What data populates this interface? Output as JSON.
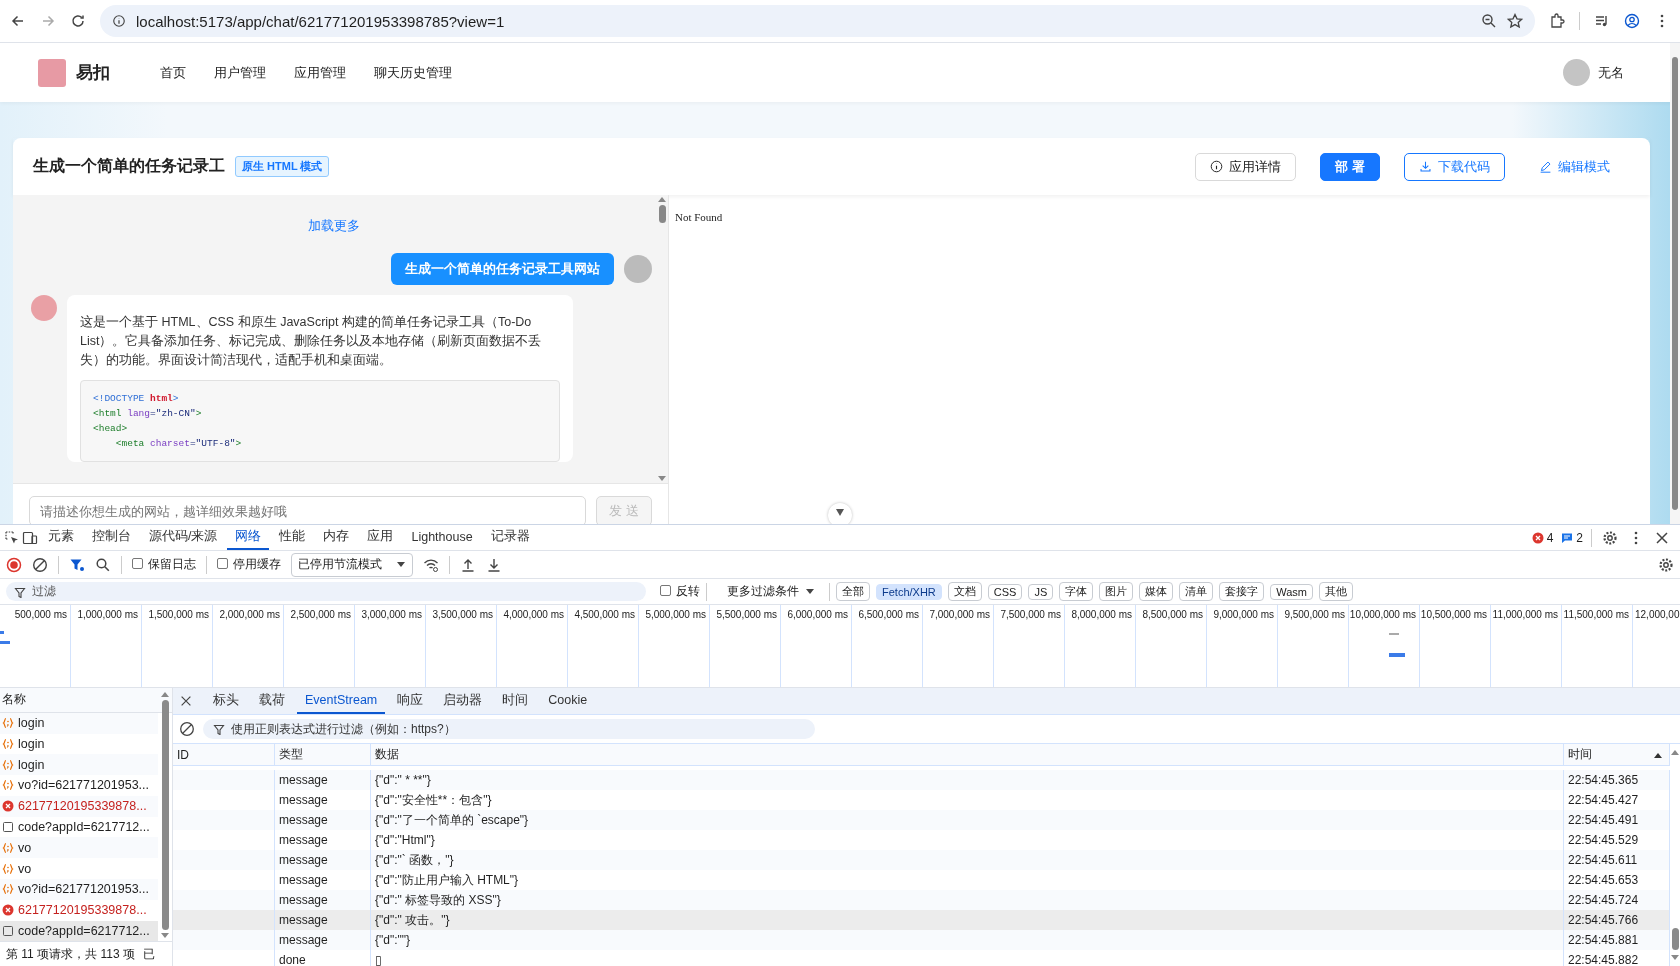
{
  "browser": {
    "url": "localhost:5173/app/chat/621771201953398785?view=1"
  },
  "app_header": {
    "brand": "易扣",
    "nav": [
      {
        "label": "首页"
      },
      {
        "label": "用户管理"
      },
      {
        "label": "应用管理"
      },
      {
        "label": "聊天历史管理"
      }
    ],
    "user": "无名"
  },
  "card": {
    "title": "生成一个简单的任务记录工",
    "badge": "原生 HTML 模式",
    "actions": [
      {
        "label": "应用详情",
        "kind": "default"
      },
      {
        "label": "部 署",
        "kind": "primary"
      },
      {
        "label": "下载代码",
        "kind": "outline"
      },
      {
        "label": "编辑模式",
        "kind": "link"
      }
    ]
  },
  "chat": {
    "load_more": "加载更多",
    "messages": [
      {
        "kind": "user",
        "text": "生成一个简单的任务记录工具网站"
      },
      {
        "kind": "ai",
        "text": "这是一个基于 HTML、CSS 和原生 JavaScript 构建的简单任务记录工具（To-Do List）。它具备添加任务、标记完成、删除任务以及本地存储（刷新页面数据不丢失）的功能。界面设计简洁现代，适配手机和桌面端。",
        "code_lines": [
          [
            {
              "text": "<!DOCTYPE ",
              "kind": "punct"
            },
            {
              "text": "html",
              "kind": "keyword"
            },
            {
              "text": ">",
              "kind": "punct"
            }
          ],
          [
            {
              "text": "<html",
              "kind": "tag"
            },
            {
              "text": " lang",
              "kind": "attr"
            },
            {
              "text": "=\"zh-CN\"",
              "kind": "string"
            },
            {
              "text": ">",
              "kind": "tag"
            }
          ],
          [
            {
              "text": "<head>",
              "kind": "tag"
            }
          ],
          [
            {
              "text": "    <meta",
              "kind": "tag"
            },
            {
              "text": " charset",
              "kind": "attr"
            },
            {
              "text": "=\"UTF-8\"",
              "kind": "string"
            },
            {
              "text": ">",
              "kind": "tag"
            }
          ]
        ]
      }
    ],
    "input": {
      "placeholder": "请描述你想生成的网站，越详细效果越好哦"
    },
    "send_button": {
      "label": "发 送",
      "disabled": true
    }
  },
  "preview": {
    "text": "Not Found"
  },
  "devtools": {
    "tabs": [
      {
        "label": "元素",
        "selected": false
      },
      {
        "label": "控制台",
        "selected": false
      },
      {
        "label": "源代码/来源",
        "selected": false
      },
      {
        "label": "网络",
        "selected": true
      },
      {
        "label": "性能",
        "selected": false
      },
      {
        "label": "内存",
        "selected": false
      },
      {
        "label": "应用",
        "selected": false
      },
      {
        "label": "Lighthouse",
        "selected": false
      },
      {
        "label": "记录器",
        "selected": false
      }
    ],
    "error_count": "4",
    "message_count": "2",
    "toolbar": {
      "preserve_log": {
        "label": "保留日志",
        "checked": false
      },
      "disable_cache": {
        "label": "停用缓存",
        "checked": false
      },
      "throttling": "已停用节流模式"
    },
    "filter": {
      "placeholder": "过滤",
      "invert": {
        "label": "反转",
        "checked": false
      },
      "more_filters": "更多过滤条件",
      "types": [
        {
          "label": "全部",
          "selected": false
        },
        {
          "label": "Fetch/XHR",
          "selected": true
        },
        {
          "label": "文档",
          "selected": false
        },
        {
          "label": "CSS",
          "selected": false
        },
        {
          "label": "JS",
          "selected": false
        },
        {
          "label": "字体",
          "selected": false
        },
        {
          "label": "图片",
          "selected": false
        },
        {
          "label": "媒体",
          "selected": false
        },
        {
          "label": "清单",
          "selected": false
        },
        {
          "label": "套接字",
          "selected": false
        },
        {
          "label": "Wasm",
          "selected": false
        },
        {
          "label": "其他",
          "selected": false
        }
      ]
    },
    "timeline": {
      "ticks": [
        "500,000 ms",
        "1,000,000 ms",
        "1,500,000 ms",
        "2,000,000 ms",
        "2,500,000 ms",
        "3,000,000 ms",
        "3,500,000 ms",
        "4,000,000 ms",
        "4,500,000 ms",
        "5,000,000 ms",
        "5,500,000 ms",
        "6,000,000 ms",
        "6,500,000 ms",
        "7,000,000 ms",
        "7,500,000 ms",
        "8,000,000 ms",
        "8,500,000 ms",
        "9,000,000 ms",
        "9,500,000 ms",
        "10,000,000 ms",
        "10,500,000 ms",
        "11,000,000 ms",
        "11,500,000 ms",
        "12,000,00"
      ]
    },
    "requests": {
      "column": "名称",
      "items": [
        {
          "name": "login",
          "kind": "fetch",
          "selected": false
        },
        {
          "name": "login",
          "kind": "fetch",
          "selected": false
        },
        {
          "name": "login",
          "kind": "fetch",
          "selected": false
        },
        {
          "name": "vo?id=621771201953...",
          "kind": "fetch",
          "selected": false
        },
        {
          "name": "62177120195339878...",
          "kind": "error",
          "selected": false
        },
        {
          "name": "code?appId=6217712...",
          "kind": "document",
          "selected": false
        },
        {
          "name": "vo",
          "kind": "fetch",
          "selected": false
        },
        {
          "name": "vo",
          "kind": "fetch",
          "selected": false
        },
        {
          "name": "vo?id=621771201953...",
          "kind": "fetch",
          "selected": false
        },
        {
          "name": "62177120195339878...",
          "kind": "error",
          "selected": false
        },
        {
          "name": "code?appId=6217712...",
          "kind": "document",
          "selected": true
        }
      ],
      "status": "第 11 项请求，共 113 项",
      "status_more": "已"
    },
    "detail": {
      "tabs": [
        {
          "label": "标头",
          "selected": false
        },
        {
          "label": "载荷",
          "selected": false
        },
        {
          "label": "EventStream",
          "selected": true
        },
        {
          "label": "响应",
          "selected": false
        },
        {
          "label": "启动器",
          "selected": false
        },
        {
          "label": "时间",
          "selected": false
        },
        {
          "label": "Cookie",
          "selected": false
        }
      ],
      "filter_placeholder": "使用正则表达式进行过滤（例如：https?）",
      "columns": [
        "ID",
        "类型",
        "数据",
        "时间"
      ],
      "events": [
        {
          "type": "message",
          "data": "{\"d\":\" * **\"}",
          "time": "22:54:45.365",
          "selected": false
        },
        {
          "type": "message",
          "data": "{\"d\":\"安全性**：包含\"}",
          "time": "22:54:45.427",
          "selected": false
        },
        {
          "type": "message",
          "data": "{\"d\":\"了一个简单的 `escape\"}",
          "time": "22:54:45.491",
          "selected": false
        },
        {
          "type": "message",
          "data": "{\"d\":\"Html\"}",
          "time": "22:54:45.529",
          "selected": false
        },
        {
          "type": "message",
          "data": "{\"d\":\"` 函数，\"}",
          "time": "22:54:45.611",
          "selected": false
        },
        {
          "type": "message",
          "data": "{\"d\":\"防止用户输入 HTML\"}",
          "time": "22:54:45.653",
          "selected": false
        },
        {
          "type": "message",
          "data": "{\"d\":\" 标签导致的 XSS\"}",
          "time": "22:54:45.724",
          "selected": false
        },
        {
          "type": "message",
          "data": "{\"d\":\" 攻击。\"}",
          "time": "22:54:45.766",
          "selected": true
        },
        {
          "type": "message",
          "data": "{\"d\":\"\"}",
          "time": "22:54:45.881",
          "selected": false
        },
        {
          "type": "done",
          "data": "▯",
          "time": "22:54:45.882",
          "selected": false
        }
      ]
    }
  }
}
